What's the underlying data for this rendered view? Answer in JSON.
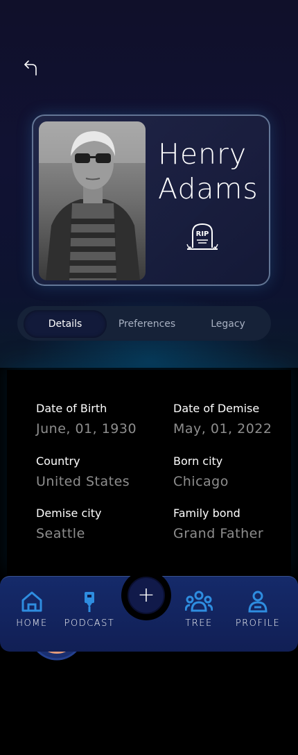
{
  "profile": {
    "first_name": "Henry",
    "last_name": "Adams",
    "rip_text": "RIP"
  },
  "tabs": [
    {
      "label": "Details",
      "active": true
    },
    {
      "label": "Preferences",
      "active": false
    },
    {
      "label": "Legacy",
      "active": false
    }
  ],
  "details": {
    "dob_label": "Date of Birth",
    "dob_value": "June, 01, 1930",
    "demise_label": "Date of Demise",
    "demise_value": "May, 01, 2022",
    "country_label": "Country",
    "country_value": "United States",
    "born_city_label": "Born city",
    "born_city_value": "Chicago",
    "demise_city_label": "Demise city",
    "demise_city_value": "Seattle",
    "family_bond_label": "Family bond",
    "family_bond_value": "Grand Father"
  },
  "nav": {
    "home": "HOME",
    "podcast": "PODCAST",
    "add": "+",
    "tree": "TREE",
    "profile": "PROFILE"
  },
  "colors": {
    "accent_blue": "#2e8de0",
    "nav_bg": "#152a6a",
    "tab_active_bg": "#121a3a"
  }
}
